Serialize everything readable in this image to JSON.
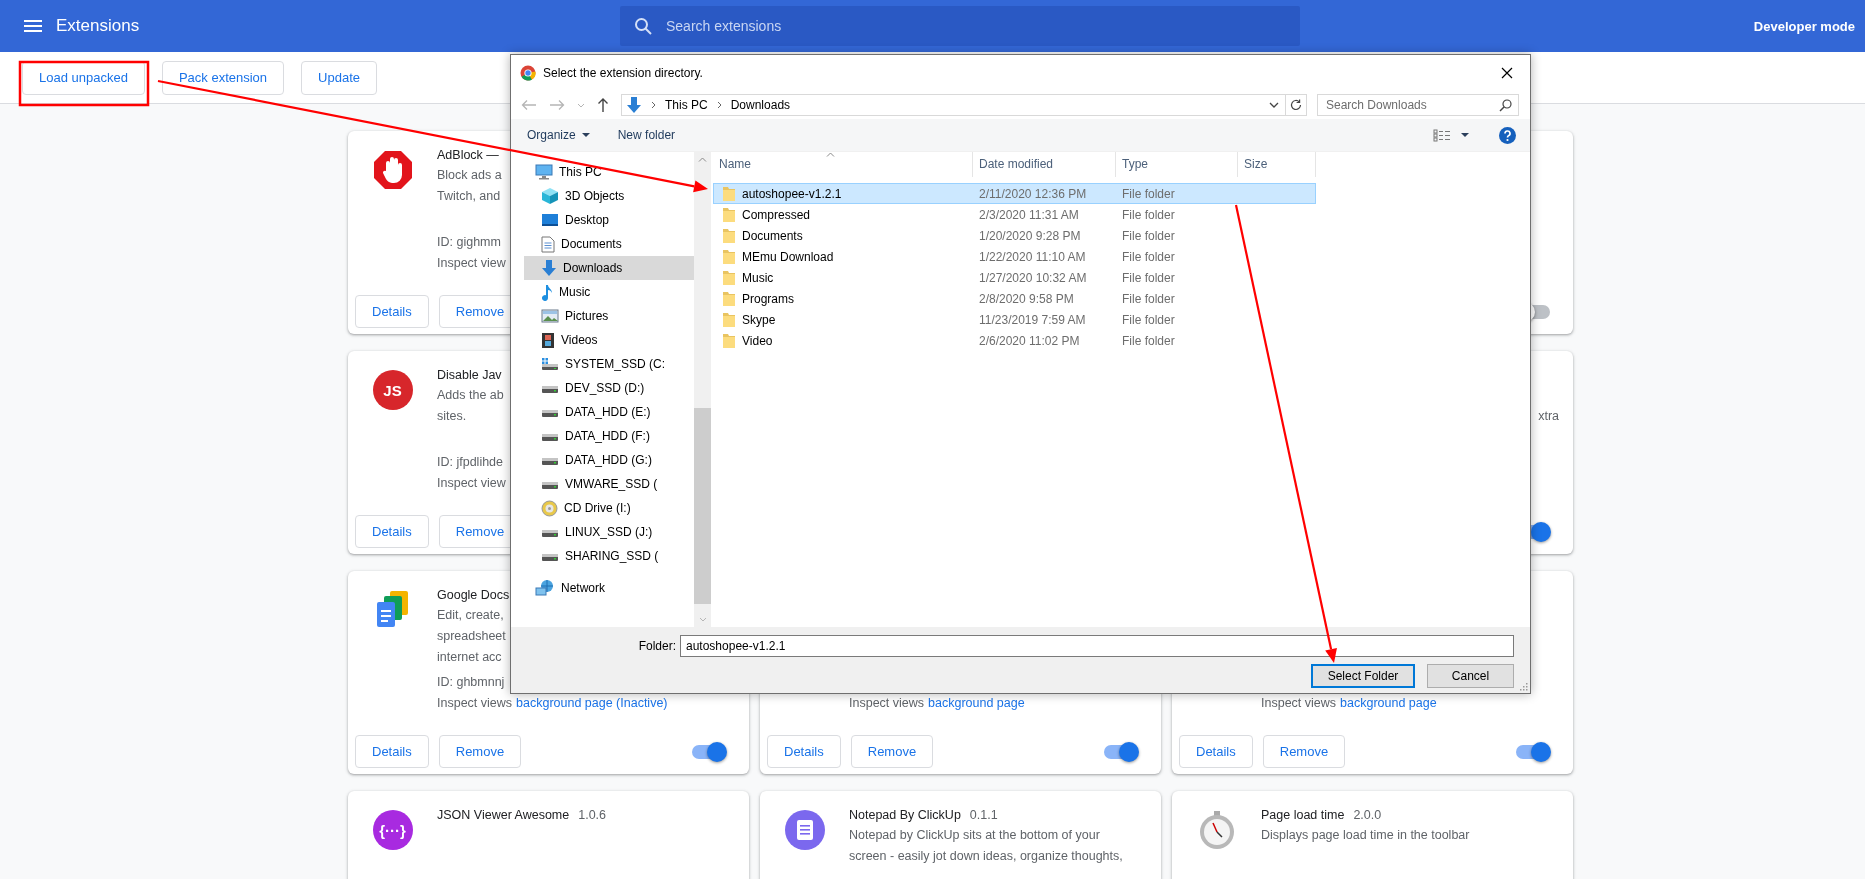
{
  "header": {
    "title": "Extensions",
    "search_placeholder": "Search extensions",
    "developer_mode_label": "Developer mode"
  },
  "toolbar": {
    "buttons": [
      "Load unpacked",
      "Pack extension",
      "Update"
    ]
  },
  "card_columns": [
    [
      {
        "name": "AdBlock —",
        "description_lines": [
          "Block ads a",
          "Twitch, and"
        ],
        "id": "ID: gighmm",
        "inspect_label": "Inspect view",
        "buttons": [
          "Details",
          "Remove"
        ]
      },
      {
        "name": "Disable Jav",
        "icon_text": "JS",
        "color": "#d7262b",
        "description_lines": [
          "Adds the ab",
          "sites."
        ],
        "id": "ID: jfpdlihde",
        "inspect_label": "Inspect view",
        "buttons": [
          "Details",
          "Remove"
        ]
      },
      {
        "name": "Google Docs",
        "description_lines": [
          "Edit, create,",
          "spreadsheet",
          "internet acc"
        ],
        "id": "ID: ghbmnnj",
        "inspect_label": "Inspect views",
        "inspect_link": "background page (Inactive)",
        "buttons": [
          "Details",
          "Remove"
        ],
        "enabled": true
      },
      {
        "name": "JSON Viewer Awesome",
        "version": "1.0.6",
        "icon_text": "{···}",
        "color": "#a82ae0"
      }
    ],
    [
      {
        "inspect_label": "Inspect views",
        "inspect_link": "background page",
        "buttons": [
          "Details",
          "Remove"
        ],
        "enabled": true
      },
      {
        "name": "Notepad By ClickUp",
        "version": "0.1.1",
        "description_lines": [
          "Notepad by ClickUp sits at the bottom of your",
          "screen - easily jot down ideas, organize thoughts,"
        ]
      }
    ],
    [
      {
        "enabled": false
      },
      {
        "description_fragment": "xtra",
        "enabled": true
      },
      {
        "inspect_label": "Inspect views",
        "inspect_link": "background page",
        "buttons": [
          "Details",
          "Remove"
        ],
        "enabled": true
      },
      {
        "name": "Page load time",
        "version": "2.0.0",
        "description_lines": [
          "Displays page load time in the toolbar"
        ]
      }
    ]
  ],
  "dialog": {
    "title": "Select the extension directory.",
    "breadcrumb": [
      "This PC",
      "Downloads"
    ],
    "search_placeholder": "Search Downloads",
    "commands": [
      "Organize",
      "New folder"
    ],
    "nav": [
      {
        "label": "This PC",
        "selected": false,
        "children": [
          {
            "label": "3D Objects",
            "selected": false
          },
          {
            "label": "Desktop",
            "selected": false
          },
          {
            "label": "Documents",
            "selected": false
          },
          {
            "label": "Downloads",
            "selected": true
          },
          {
            "label": "Music",
            "selected": false
          },
          {
            "label": "Pictures",
            "selected": false
          },
          {
            "label": "Videos",
            "selected": false
          },
          {
            "label": "SYSTEM_SSD (C:",
            "selected": false
          },
          {
            "label": "DEV_SSD (D:)",
            "selected": false
          },
          {
            "label": "DATA_HDD (E:)",
            "selected": false
          },
          {
            "label": "DATA_HDD (F:)",
            "selected": false
          },
          {
            "label": "DATA_HDD (G:)",
            "selected": false
          },
          {
            "label": "VMWARE_SSD (",
            "selected": false
          },
          {
            "label": "CD Drive (I:)",
            "selected": false
          },
          {
            "label": "LINUX_SSD (J:)",
            "selected": false
          },
          {
            "label": "SHARING_SSD (",
            "selected": false
          }
        ]
      },
      {
        "label": "Network",
        "selected": false
      }
    ],
    "columns": [
      "Name",
      "Date modified",
      "Type",
      "Size"
    ],
    "files": [
      {
        "name": "autoshopee-v1.2.1",
        "date": "2/11/2020 12:36 PM",
        "type": "File folder",
        "selected": true
      },
      {
        "name": "Compressed",
        "date": "2/3/2020 11:31 AM",
        "type": "File folder",
        "selected": false
      },
      {
        "name": "Documents",
        "date": "1/20/2020 9:28 PM",
        "type": "File folder",
        "selected": false
      },
      {
        "name": "MEmu Download",
        "date": "1/22/2020 11:10 AM",
        "type": "File folder",
        "selected": false
      },
      {
        "name": "Music",
        "date": "1/27/2020 10:32 AM",
        "type": "File folder",
        "selected": false
      },
      {
        "name": "Programs",
        "date": "2/8/2020 9:58 PM",
        "type": "File folder",
        "selected": false
      },
      {
        "name": "Skype",
        "date": "11/23/2019 7:59 AM",
        "type": "File folder",
        "selected": false
      },
      {
        "name": "Video",
        "date": "2/6/2020 11:02 PM",
        "type": "File folder",
        "selected": false
      }
    ],
    "folder_label": "Folder:",
    "folder_value": "autoshopee-v1.2.1",
    "buttons": [
      {
        "label": "Select Folder",
        "default": true
      },
      {
        "label": "Cancel",
        "default": false
      }
    ]
  }
}
